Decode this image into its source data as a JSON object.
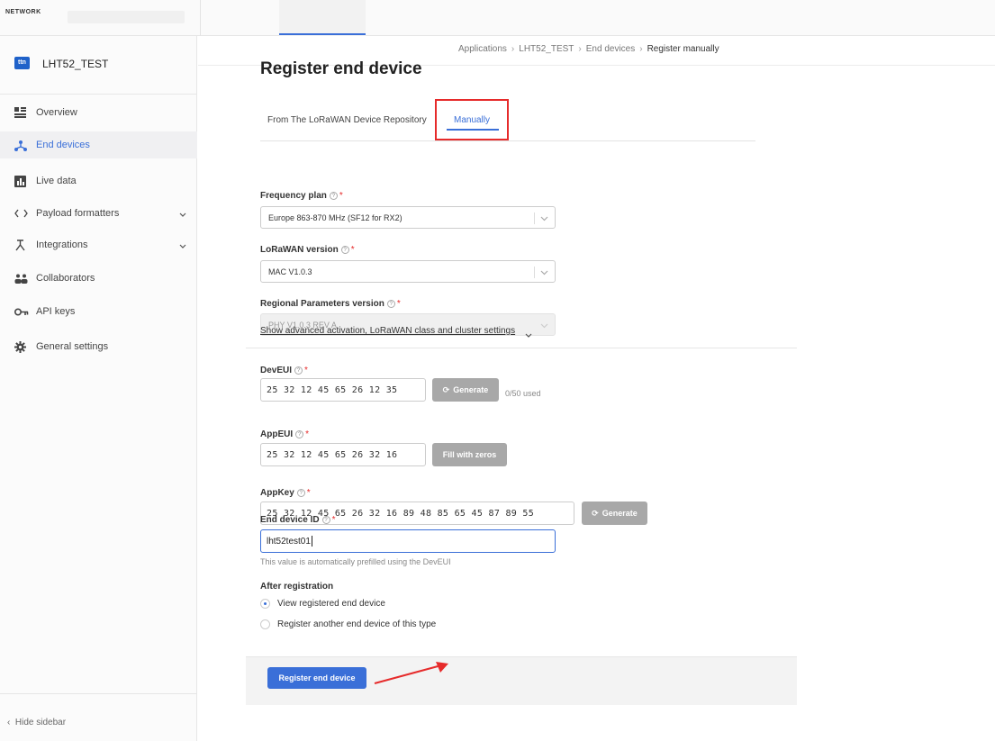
{
  "topbar": {
    "brand": "NETWORK"
  },
  "sidebar": {
    "app_name": "LHT52_TEST",
    "app_logo": "ttn",
    "items": [
      {
        "label": "Overview",
        "icon": "grid-icon"
      },
      {
        "label": "End devices",
        "icon": "network-icon",
        "active": true
      },
      {
        "label": "Live data",
        "icon": "chart-icon"
      },
      {
        "label": "Payload formatters",
        "icon": "code-icon",
        "expandable": true
      },
      {
        "label": "Integrations",
        "icon": "integrations-icon",
        "expandable": true
      },
      {
        "label": "Collaborators",
        "icon": "users-icon"
      },
      {
        "label": "API keys",
        "icon": "key-icon"
      },
      {
        "label": "General settings",
        "icon": "gear-icon"
      }
    ],
    "hide_label": "Hide sidebar"
  },
  "breadcrumb": [
    "Applications",
    "LHT52_TEST",
    "End devices",
    "Register manually"
  ],
  "page_title": "Register end device",
  "tabs": [
    {
      "label": "From The LoRaWAN Device Repository",
      "selected": false
    },
    {
      "label": "Manually",
      "selected": true
    }
  ],
  "form": {
    "frequency_plan": {
      "label": "Frequency plan",
      "value": "Europe 863-870 MHz (SF12 for RX2)"
    },
    "lorawan_version": {
      "label": "LoRaWAN version",
      "value": "MAC V1.0.3"
    },
    "regional_params": {
      "label": "Regional Parameters version",
      "value": "PHY V1.0.3 REV A"
    },
    "advanced_link": "Show advanced activation, LoRaWAN class and cluster settings",
    "dev_eui": {
      "label": "DevEUI",
      "value": "25 32 12 45 65 26 12 35",
      "button": "Generate",
      "used": "0/50 used"
    },
    "app_eui": {
      "label": "AppEUI",
      "value": "25 32 12 45 65 26 32 16",
      "button": "Fill with zeros"
    },
    "app_key": {
      "label": "AppKey",
      "value": "25 32 12 45 65 26 32 16 89 48 85 65 45 87 89 55",
      "button": "Generate"
    },
    "end_device_id": {
      "label": "End device ID",
      "value": "lht52test01",
      "hint": "This value is automatically prefilled using the DevEUI"
    },
    "after_registration": {
      "label": "After registration",
      "options": [
        {
          "label": "View registered end device",
          "selected": true
        },
        {
          "label": "Register another end device of this type",
          "selected": false
        }
      ]
    },
    "submit": "Register end device"
  },
  "colors": {
    "accent": "#3a6fd8",
    "annotation": "#e62b2b"
  }
}
